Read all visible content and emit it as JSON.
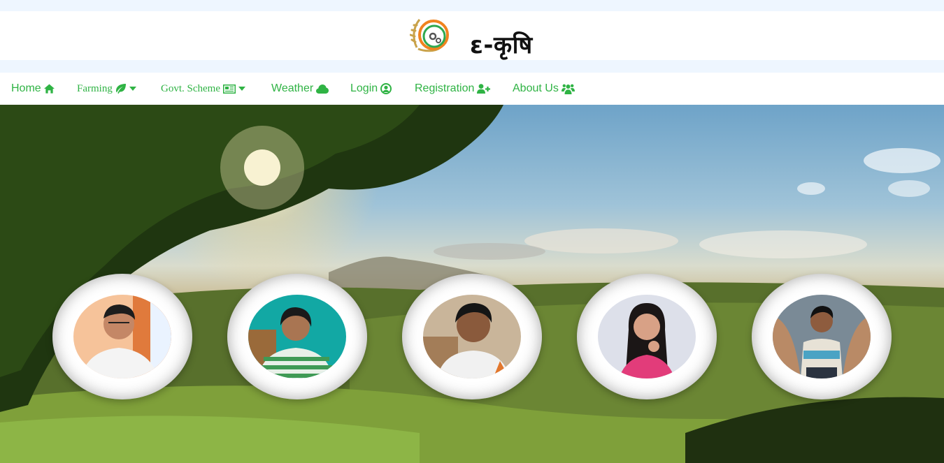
{
  "brand": {
    "title": "ε-कृषि",
    "logo_icon": "leaf-gear-logo-icon"
  },
  "nav": [
    {
      "label": "Home",
      "icon": "home-icon"
    },
    {
      "label": "Farming",
      "icon": "leaf-icon",
      "dropdown": true
    },
    {
      "label": "Govt. Scheme",
      "icon": "newspaper-icon",
      "dropdown": true
    },
    {
      "label": "Weather",
      "icon": "cloud-icon"
    },
    {
      "label": "Login",
      "icon": "user-circle-icon"
    },
    {
      "label": "Registration",
      "icon": "user-plus-icon"
    },
    {
      "label": "About Us",
      "icon": "users-icon"
    }
  ],
  "colors": {
    "accent": "#2fb344",
    "page_bg": "#eef6ff",
    "nav_bg": "#ffffff"
  },
  "team_members": 5
}
